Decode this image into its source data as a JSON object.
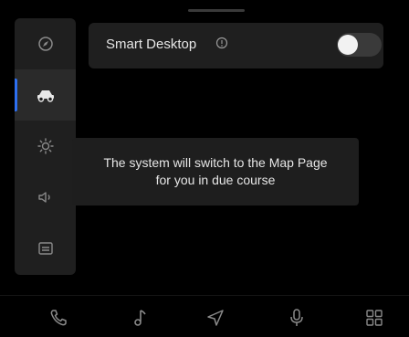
{
  "settings": {
    "smart_desktop_label": "Smart Desktop",
    "smart_desktop_enabled": true
  },
  "toast": {
    "line1": "The system will switch to the Map Page",
    "line2": "for you in due course"
  },
  "sidebar": {
    "items": [
      {
        "icon": "compass-icon"
      },
      {
        "icon": "car-icon",
        "active": true
      },
      {
        "icon": "brightness-icon"
      },
      {
        "icon": "volume-icon"
      },
      {
        "icon": "message-icon"
      }
    ]
  },
  "bottom_nav": {
    "items": [
      {
        "icon": "phone-icon"
      },
      {
        "icon": "music-icon"
      },
      {
        "icon": "navigation-icon"
      },
      {
        "icon": "microphone-icon"
      },
      {
        "icon": "apps-grid-icon"
      }
    ]
  },
  "colors": {
    "background": "#000000",
    "panel": "#1f1f1f",
    "accent": "#2d6ff0",
    "toggle_knob": "#f2f2f2"
  }
}
